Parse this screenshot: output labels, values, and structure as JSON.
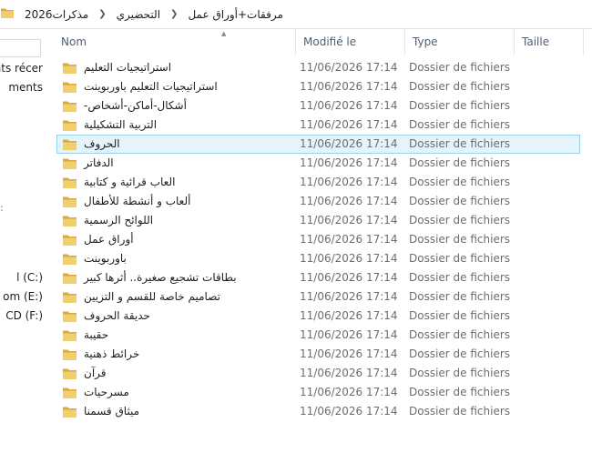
{
  "address": {
    "crumbs": [
      "مذكرات2026",
      "التحضيري",
      "مرفقات+أوراق عمل"
    ]
  },
  "nav": {
    "items": [
      "ents récer",
      "ments",
      "l (C:)",
      "om (E:)",
      "CD (F:)"
    ],
    "mark": ":"
  },
  "columns": {
    "name": "Nom",
    "date": "Modifié le",
    "type": "Type",
    "size": "Taille"
  },
  "files": [
    {
      "name": "استراتيجيات التعليم",
      "date": "11/06/2026 17:14",
      "type": "Dossier de fichiers"
    },
    {
      "name": "استراتيجيات التعليم باوربوينت",
      "date": "11/06/2026 17:14",
      "type": "Dossier de fichiers"
    },
    {
      "name": "أشكال-أماكن-أشخاص-",
      "date": "11/06/2026 17:14",
      "type": "Dossier de fichiers"
    },
    {
      "name": "التربية التشكيلية",
      "date": "11/06/2026 17:14",
      "type": "Dossier de fichiers"
    },
    {
      "name": "الحروف",
      "date": "11/06/2026 17:14",
      "type": "Dossier de fichiers",
      "selected": true
    },
    {
      "name": "الدفاتر",
      "date": "11/06/2026 17:14",
      "type": "Dossier de fichiers"
    },
    {
      "name": "العاب قرائية و كتابية",
      "date": "11/06/2026 17:14",
      "type": "Dossier de fichiers"
    },
    {
      "name": "ألعاب و أنشطة للأطفال",
      "date": "11/06/2026 17:14",
      "type": "Dossier de fichiers"
    },
    {
      "name": "اللوائح الرسمية",
      "date": "11/06/2026 17:14",
      "type": "Dossier de fichiers"
    },
    {
      "name": "أوراق عمل",
      "date": "11/06/2026 17:14",
      "type": "Dossier de fichiers"
    },
    {
      "name": "باوربوينت",
      "date": "11/06/2026 17:14",
      "type": "Dossier de fichiers"
    },
    {
      "name": "بطاقات تشجيع صغيرة.. أثرها كبير",
      "date": "11/06/2026 17:14",
      "type": "Dossier de fichiers"
    },
    {
      "name": "تصاميم خاصة للقسم و التزيين",
      "date": "11/06/2026 17:14",
      "type": "Dossier de fichiers"
    },
    {
      "name": "حديقة الحروف",
      "date": "11/06/2026 17:14",
      "type": "Dossier de fichiers"
    },
    {
      "name": "حقيبة",
      "date": "11/06/2026 17:14",
      "type": "Dossier de fichiers"
    },
    {
      "name": "خرائط ذهنية",
      "date": "11/06/2026 17:14",
      "type": "Dossier de fichiers"
    },
    {
      "name": "قرآن",
      "date": "11/06/2026 17:14",
      "type": "Dossier de fichiers"
    },
    {
      "name": "مسرحيات",
      "date": "11/06/2026 17:14",
      "type": "Dossier de fichiers"
    },
    {
      "name": "ميثاق قسمنا",
      "date": "11/06/2026 17:14",
      "type": "Dossier de fichiers"
    }
  ],
  "icons": {
    "folder": "folder-icon",
    "sort": "sort-ascending-icon",
    "separator": "chevron-right-icon"
  },
  "colors": {
    "selection_bg": "#e5f3fb",
    "selection_border": "#99d1ef",
    "header_text": "#4c607a",
    "folder": "#e8c15a"
  }
}
